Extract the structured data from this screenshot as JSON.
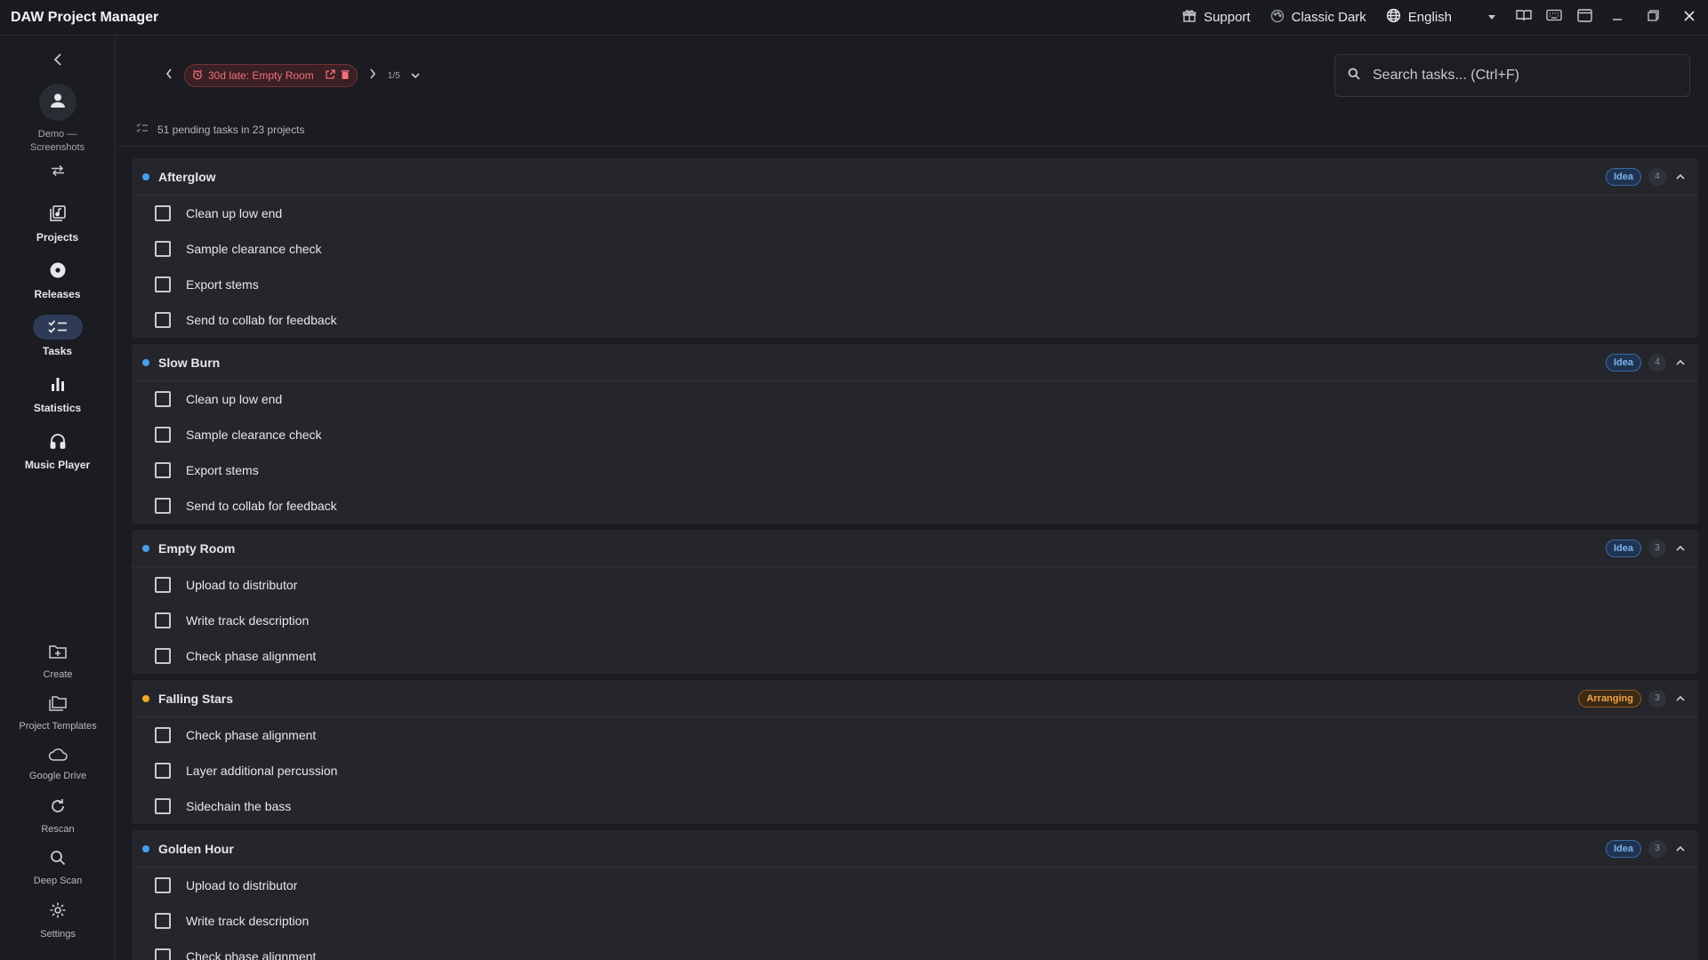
{
  "window": {
    "title": "DAW Project Manager"
  },
  "titlebar": {
    "support_label": "Support",
    "theme_label": "Classic Dark",
    "language_label": "English"
  },
  "sidebar": {
    "workspace": "Demo — Screenshots",
    "nav": [
      {
        "label": "Projects",
        "icon": "projects-icon"
      },
      {
        "label": "Releases",
        "icon": "disc-icon"
      },
      {
        "label": "Tasks",
        "icon": "tasks-icon",
        "active": true
      },
      {
        "label": "Statistics",
        "icon": "bar-chart-icon"
      },
      {
        "label": "Music Player",
        "icon": "headphones-icon"
      }
    ],
    "tools": [
      {
        "label": "Create",
        "icon": "folder-plus-icon"
      },
      {
        "label": "Project Templates",
        "icon": "templates-icon"
      },
      {
        "label": "Google Drive",
        "icon": "cloud-icon"
      },
      {
        "label": "Rescan",
        "icon": "refresh-icon"
      },
      {
        "label": "Deep Scan",
        "icon": "search-icon"
      },
      {
        "label": "Settings",
        "icon": "gear-icon"
      }
    ]
  },
  "notification": {
    "label": "30d late: Empty Room",
    "pager": "1/5"
  },
  "search": {
    "placeholder": "Search tasks... (Ctrl+F)",
    "value": ""
  },
  "summary": {
    "text": "51 pending tasks in 23 projects"
  },
  "colors": {
    "idea": "#4a9eed",
    "arranging": "#f5a623",
    "accent": "#2e3b57",
    "late": "#f07076"
  },
  "groups": [
    {
      "name": "Afterglow",
      "status": "Idea",
      "count": "4",
      "tasks": [
        "Clean up low end",
        "Sample clearance check",
        "Export stems",
        "Send to collab for feedback"
      ]
    },
    {
      "name": "Slow Burn",
      "status": "Idea",
      "count": "4",
      "tasks": [
        "Clean up low end",
        "Sample clearance check",
        "Export stems",
        "Send to collab for feedback"
      ]
    },
    {
      "name": "Empty Room",
      "status": "Idea",
      "count": "3",
      "tasks": [
        "Upload to distributor",
        "Write track description",
        "Check phase alignment"
      ]
    },
    {
      "name": "Falling Stars",
      "status": "Arranging",
      "count": "3",
      "tasks": [
        "Check phase alignment",
        "Layer additional percussion",
        "Sidechain the bass"
      ]
    },
    {
      "name": "Golden Hour",
      "status": "Idea",
      "count": "3",
      "tasks": [
        "Upload to distributor",
        "Write track description",
        "Check phase alignment"
      ]
    }
  ]
}
